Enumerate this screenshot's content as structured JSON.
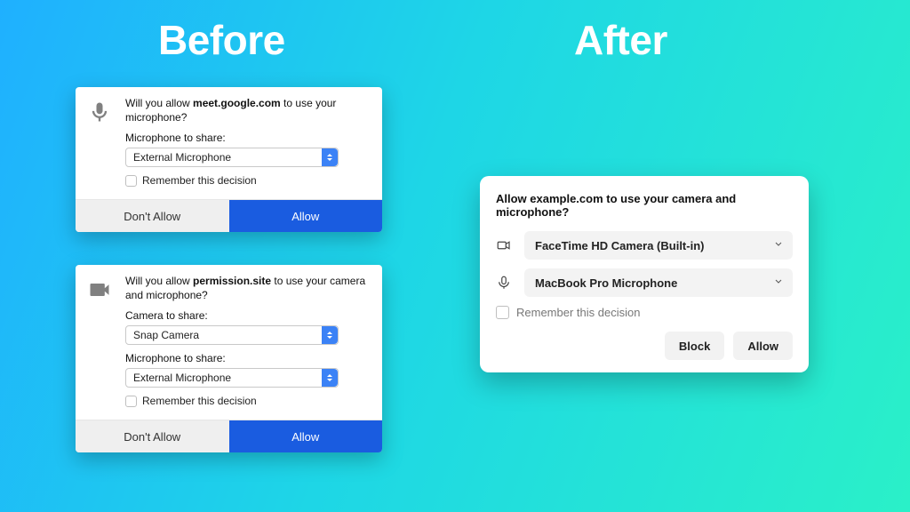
{
  "headings": {
    "before": "Before",
    "after": "After"
  },
  "before1": {
    "prompt_pre": "Will you allow ",
    "site": "meet.google.com",
    "prompt_post": " to use your microphone?",
    "mic_label": "Microphone to share:",
    "mic_value": "External Microphone",
    "remember": "Remember this decision",
    "dont": "Don't Allow",
    "allow": "Allow"
  },
  "before2": {
    "prompt_pre": "Will you allow ",
    "site": "permission.site",
    "prompt_post": " to use your camera and microphone?",
    "cam_label": "Camera to share:",
    "cam_value": "Snap Camera",
    "mic_label": "Microphone to share:",
    "mic_value": "External Microphone",
    "remember": "Remember this decision",
    "dont": "Don't Allow",
    "allow": "Allow"
  },
  "after": {
    "title": "Allow example.com to use your camera and microphone?",
    "camera_value": "FaceTime HD Camera (Built-in)",
    "mic_value": "MacBook Pro Microphone",
    "remember": "Remember this decision",
    "block": "Block",
    "allow": "Allow"
  }
}
